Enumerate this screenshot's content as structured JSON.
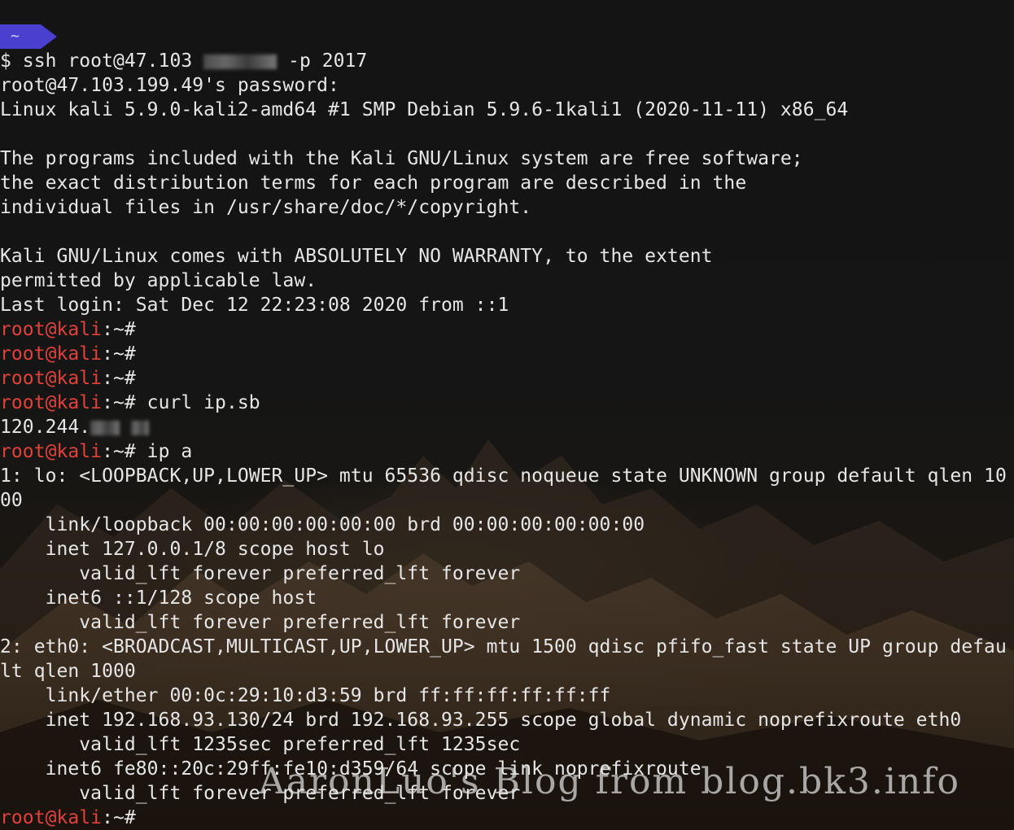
{
  "prompt_tab": {
    "label": "~",
    "color": "#4b3fd0"
  },
  "colors": {
    "prompt_user": "#e0423a",
    "text": "#e6e6e6"
  },
  "lines": [
    {
      "text": "$ ssh root@47.103 "
    },
    {
      "text": " -p 2017"
    },
    {
      "text": "root@47.103.199.49's password:"
    },
    {
      "text": "Linux kali 5.9.0-kali2-amd64 #1 SMP Debian 5.9.6-1kali1 (2020-11-11) x86_64"
    },
    {
      "text": ""
    },
    {
      "text": "The programs included with the Kali GNU/Linux system are free software;"
    },
    {
      "text": "the exact distribution terms for each program are described in the"
    },
    {
      "text": "individual files in /usr/share/doc/*/copyright."
    },
    {
      "text": ""
    },
    {
      "text": "Kali GNU/Linux comes with ABSOLUTELY NO WARRANTY, to the extent"
    },
    {
      "text": "permitted by applicable law."
    },
    {
      "text": "Last login: Sat Dec 12 22:23:08 2020 from ::1"
    },
    {
      "user": "root@kali",
      "sep": ":~#",
      "cmd": ""
    },
    {
      "user": "root@kali",
      "sep": ":~#",
      "cmd": ""
    },
    {
      "user": "root@kali",
      "sep": ":~#",
      "cmd": ""
    },
    {
      "user": "root@kali",
      "sep": ":~#",
      "cmd": " curl ip.sb"
    },
    {
      "text": "120.244."
    },
    {
      "user": "root@kali",
      "sep": ":~#",
      "cmd": " ip a"
    },
    {
      "text": "1: lo: <LOOPBACK,UP,LOWER_UP> mtu 65536 qdisc noqueue state UNKNOWN group default qlen 10"
    },
    {
      "text": "00"
    },
    {
      "text": "    link/loopback 00:00:00:00:00:00 brd 00:00:00:00:00:00"
    },
    {
      "text": "    inet 127.0.0.1/8 scope host lo"
    },
    {
      "text": "       valid_lft forever preferred_lft forever"
    },
    {
      "text": "    inet6 ::1/128 scope host"
    },
    {
      "text": "       valid_lft forever preferred_lft forever"
    },
    {
      "text": "2: eth0: <BROADCAST,MULTICAST,UP,LOWER_UP> mtu 1500 qdisc pfifo_fast state UP group defau"
    },
    {
      "text": "lt qlen 1000"
    },
    {
      "text": "    link/ether 00:0c:29:10:d3:59 brd ff:ff:ff:ff:ff:ff"
    },
    {
      "text": "    inet 192.168.93.130/24 brd 192.168.93.255 scope global dynamic noprefixroute eth0"
    },
    {
      "text": "       valid_lft 1235sec preferred_lft 1235sec"
    },
    {
      "text": "    inet6 fe80::20c:29ff:fe10:d359/64 scope link noprefixroute"
    },
    {
      "text": "       valid_lft forever preferred_lft forever"
    },
    {
      "user": "root@kali",
      "sep": ":~#",
      "cmd": ""
    }
  ],
  "watermark": "AaronLuo's Blog from  blog.bk3.info"
}
